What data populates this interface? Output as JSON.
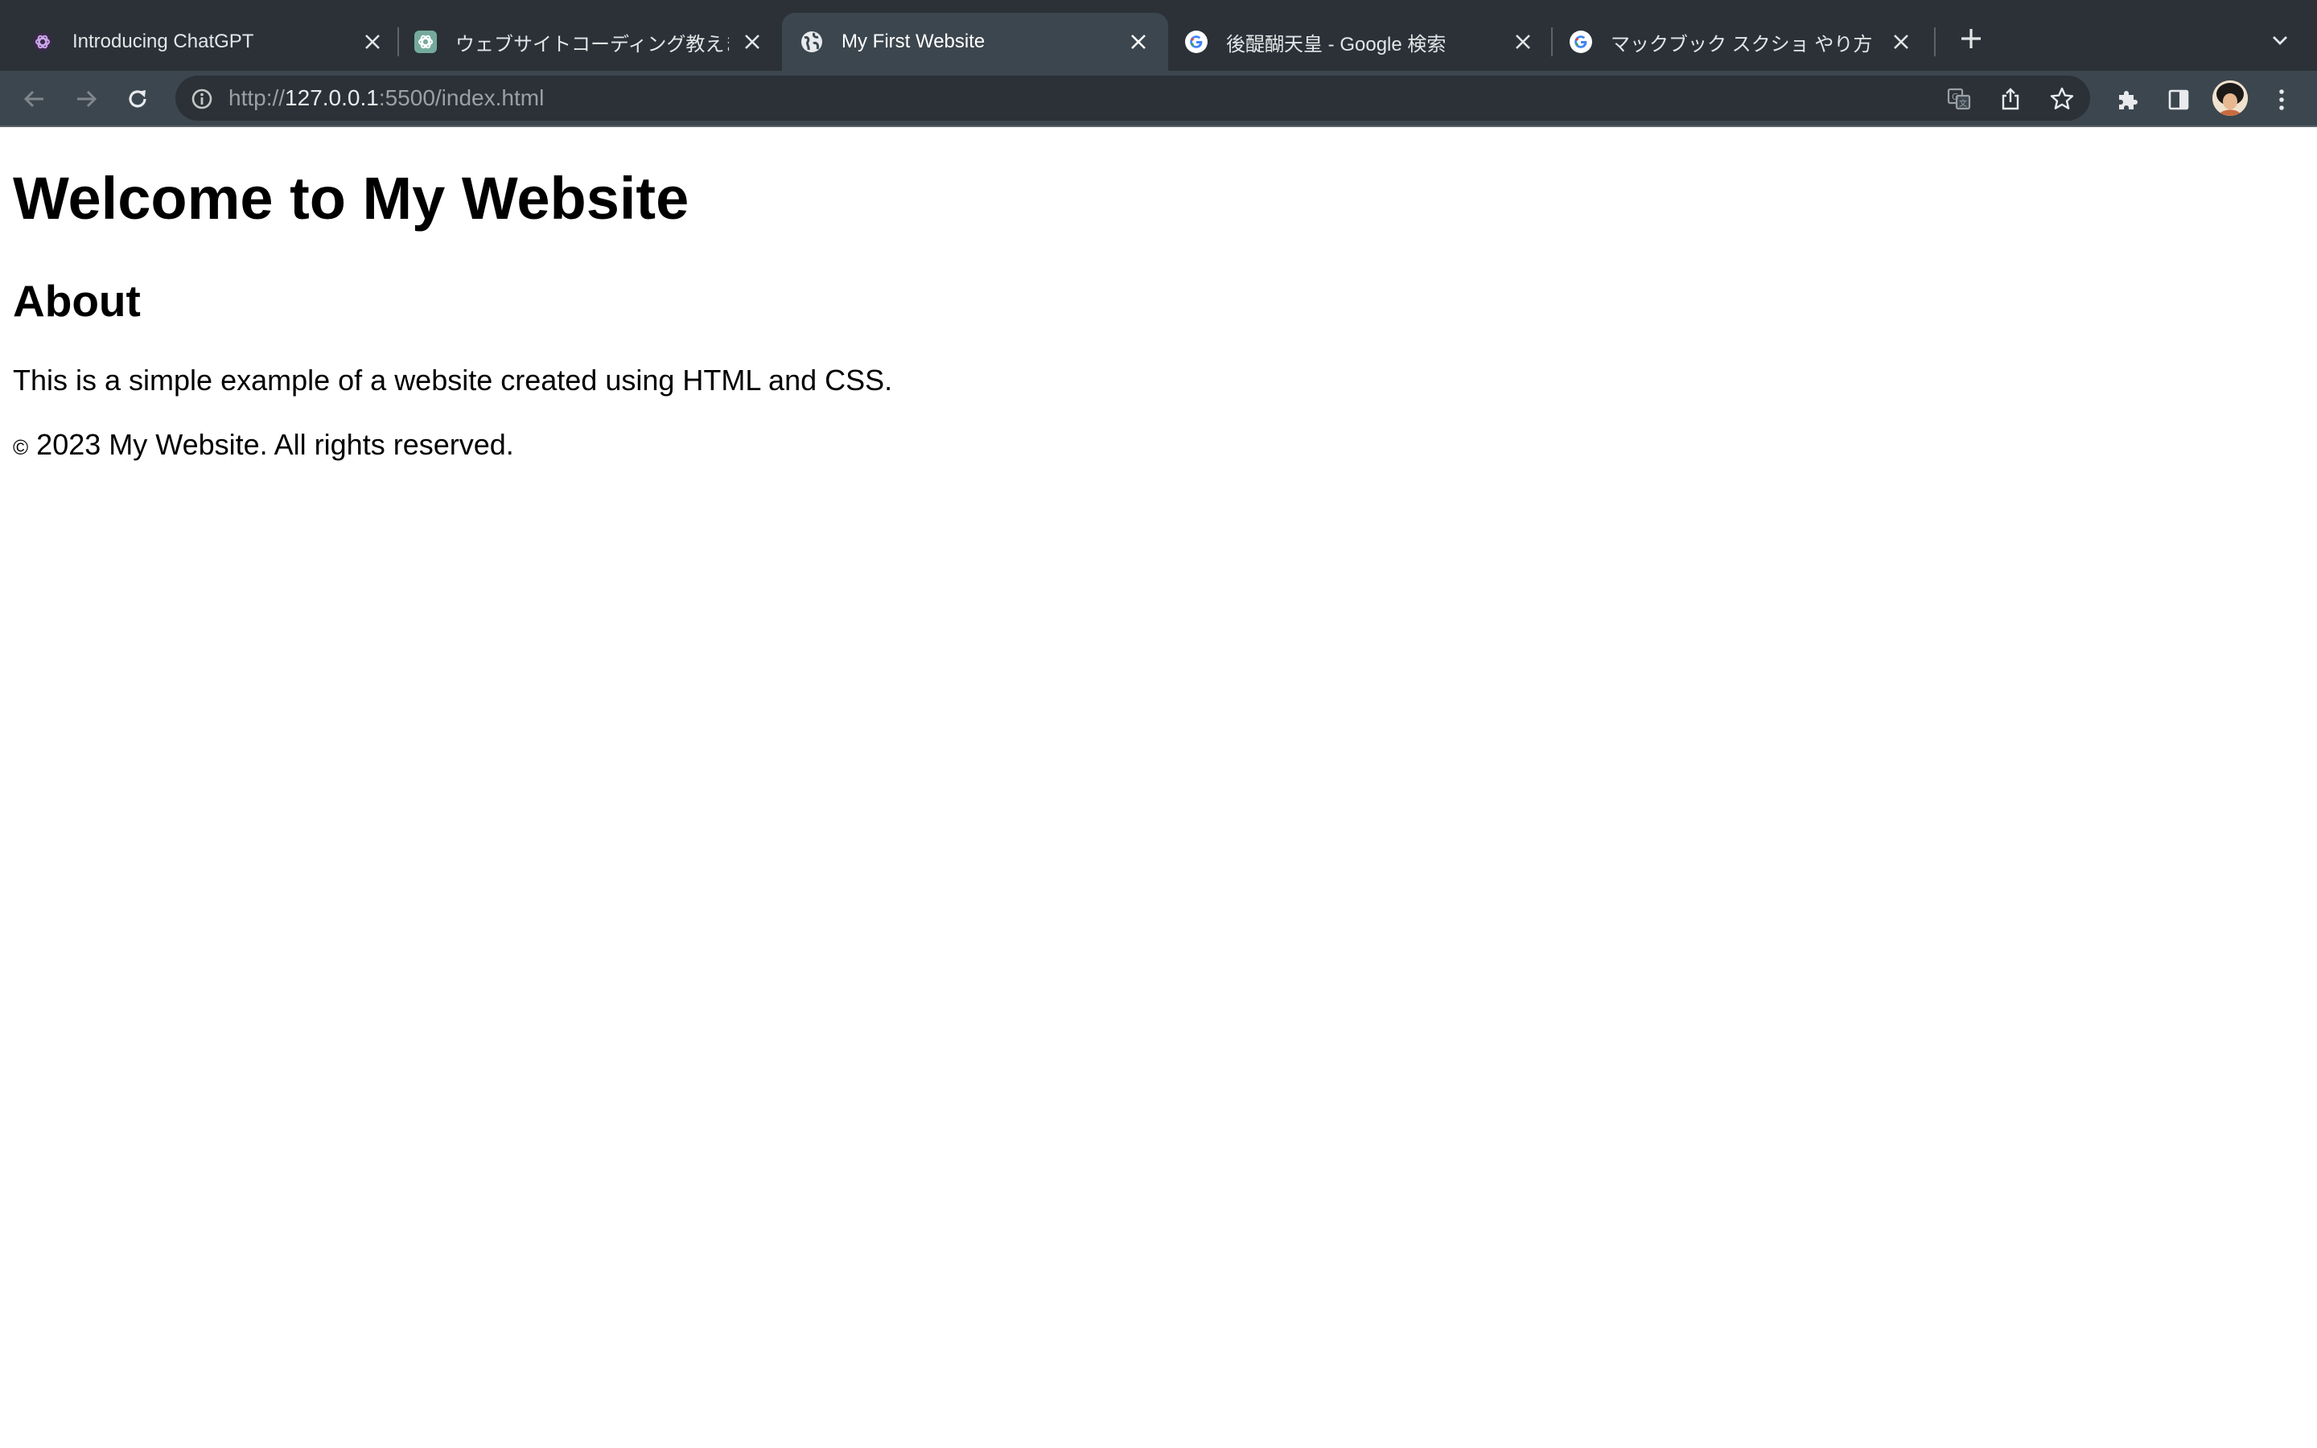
{
  "browser": {
    "tabs": [
      {
        "title": "Introducing ChatGPT",
        "favicon": "openai-icon",
        "active": false
      },
      {
        "title": "ウェブサイトコーディング教えます",
        "favicon": "chatgpt-icon",
        "active": false
      },
      {
        "title": "My First Website",
        "favicon": "globe-icon",
        "active": true
      },
      {
        "title": "後醍醐天皇 - Google 検索",
        "favicon": "google-icon",
        "active": false
      },
      {
        "title": "マックブック スクショ やり方 - Google",
        "favicon": "google-icon",
        "active": false
      }
    ],
    "url": {
      "scheme": "http://",
      "host": "127.0.0.1",
      "rest": ":5500/index.html"
    },
    "colors": {
      "tabstrip": "#2b3137",
      "toolbar": "#3c464e",
      "omnibox": "#2b3137"
    }
  },
  "page": {
    "heading": "Welcome to My Website",
    "section_title": "About",
    "body_text": "This is a simple example of a website created using HTML and CSS.",
    "footer_symbol": "©",
    "footer_text": " 2023 My Website. All rights reserved."
  }
}
